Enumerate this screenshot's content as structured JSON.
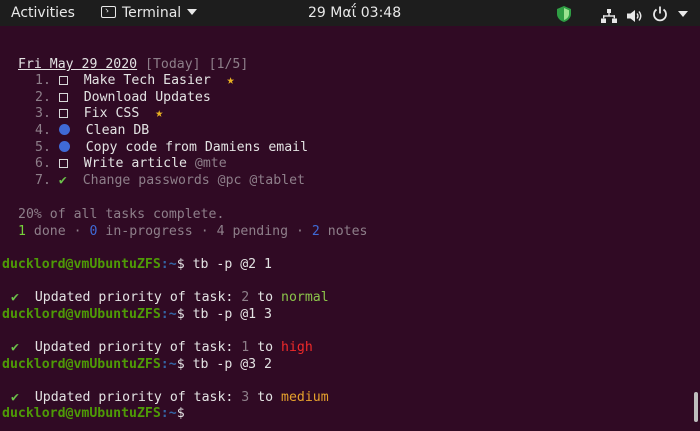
{
  "topbar": {
    "activities": "Activities",
    "app_name": "Terminal",
    "clock": "29 Μαΐ  03:48"
  },
  "terminal": {
    "header": {
      "date": "Fri May 29 2020",
      "tag": "[Today]",
      "count": "[1/5]"
    },
    "tasks": [
      {
        "num": "1.",
        "text": "Make Tech Easier",
        "star": "★"
      },
      {
        "num": "2.",
        "text": "Download Updates"
      },
      {
        "num": "3.",
        "text": "Fix CSS",
        "star": "★"
      },
      {
        "num": "4.",
        "text": "Clean DB"
      },
      {
        "num": "5.",
        "text": "Copy code from Damiens email"
      },
      {
        "num": "6.",
        "text": "Write article",
        "tag": "@mte"
      },
      {
        "num": "7.",
        "check": "✔",
        "text": "Change passwords @pc @tablet"
      }
    ],
    "summary": {
      "percent": "20% of all tasks complete.",
      "done_n": "1",
      "done_label": "done",
      "inprog_n": "0",
      "inprog_label": "in-progress",
      "pending_n": "4",
      "pending_label": "pending",
      "notes_n": "2",
      "notes_label": "notes",
      "sep": " · "
    },
    "prompt": {
      "user": "ducklord@vmUbuntuZFS",
      "path": ":~",
      "symbol": "$"
    },
    "commands": [
      {
        "cmd": "tb -p @2 1",
        "msg": "Updated priority of task:",
        "task": "2",
        "word": "to",
        "level": "normal"
      },
      {
        "cmd": "tb -p @1 3",
        "msg": "Updated priority of task:",
        "task": "1",
        "word": "to",
        "level": "high"
      },
      {
        "cmd": "tb -p @3 2",
        "msg": "Updated priority of task:",
        "task": "3",
        "word": "to",
        "level": "medium"
      }
    ],
    "checkmark": "✔"
  },
  "colors": {
    "background": "#300a24",
    "topbar": "#1d1d1d",
    "prompt_user": "#4e9a06",
    "prompt_path": "#3465a4",
    "normal": "#8bc34a",
    "high": "#ef2929",
    "medium": "#e5a12c"
  }
}
